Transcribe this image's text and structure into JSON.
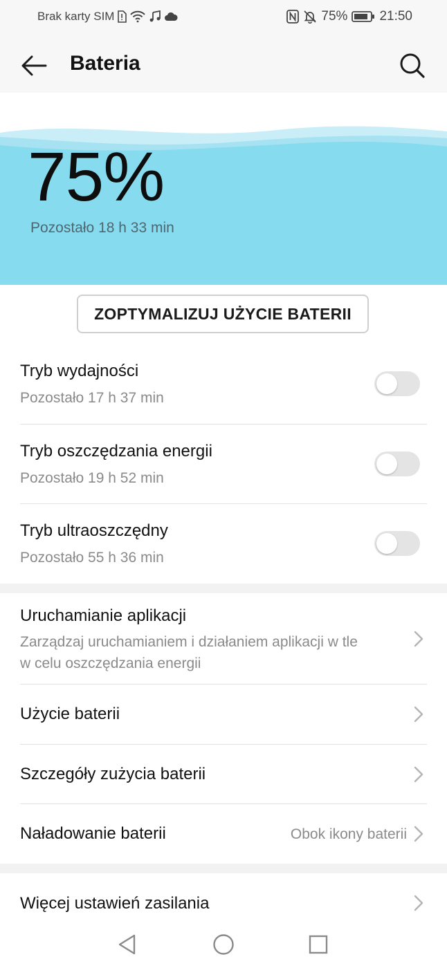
{
  "status": {
    "carrier": "Brak karty SIM",
    "battery_percent": "75%",
    "time": "21:50"
  },
  "header": {
    "title": "Bateria"
  },
  "hero": {
    "percent": "75%",
    "remaining": "Pozostało 18 h 33 min",
    "wave_color": "#86dbee"
  },
  "optimize_label": "ZOPTYMALIZUJ UŻYCIE BATERII",
  "modes": [
    {
      "title": "Tryb wydajności",
      "subtitle": "Pozostało 17 h 37 min",
      "enabled": false
    },
    {
      "title": "Tryb oszczędzania energii",
      "subtitle": "Pozostało 19 h 52 min",
      "enabled": false
    },
    {
      "title": "Tryb ultraoszczędny",
      "subtitle": "Pozostało 55 h 36 min",
      "enabled": false
    }
  ],
  "settings": {
    "app_launch": {
      "title": "Uruchamianie aplikacji",
      "subtitle_line1": "Zarządzaj uruchamianiem i działaniem aplikacji w tle",
      "subtitle_line2": "w celu oszczędzania energii"
    },
    "battery_usage": {
      "title": "Użycie baterii"
    },
    "usage_details": {
      "title": "Szczegóły zużycia baterii"
    },
    "battery_level": {
      "title": "Naładowanie baterii",
      "value": "Obok ikony baterii"
    },
    "more_power": {
      "title": "Więcej ustawień zasilania"
    }
  },
  "icons": {
    "back": "arrow-left-icon",
    "search": "search-icon",
    "chevron": "chevron-right-icon",
    "nav_back": "triangle-back-icon",
    "nav_home": "circle-home-icon",
    "nav_recents": "square-recents-icon"
  }
}
